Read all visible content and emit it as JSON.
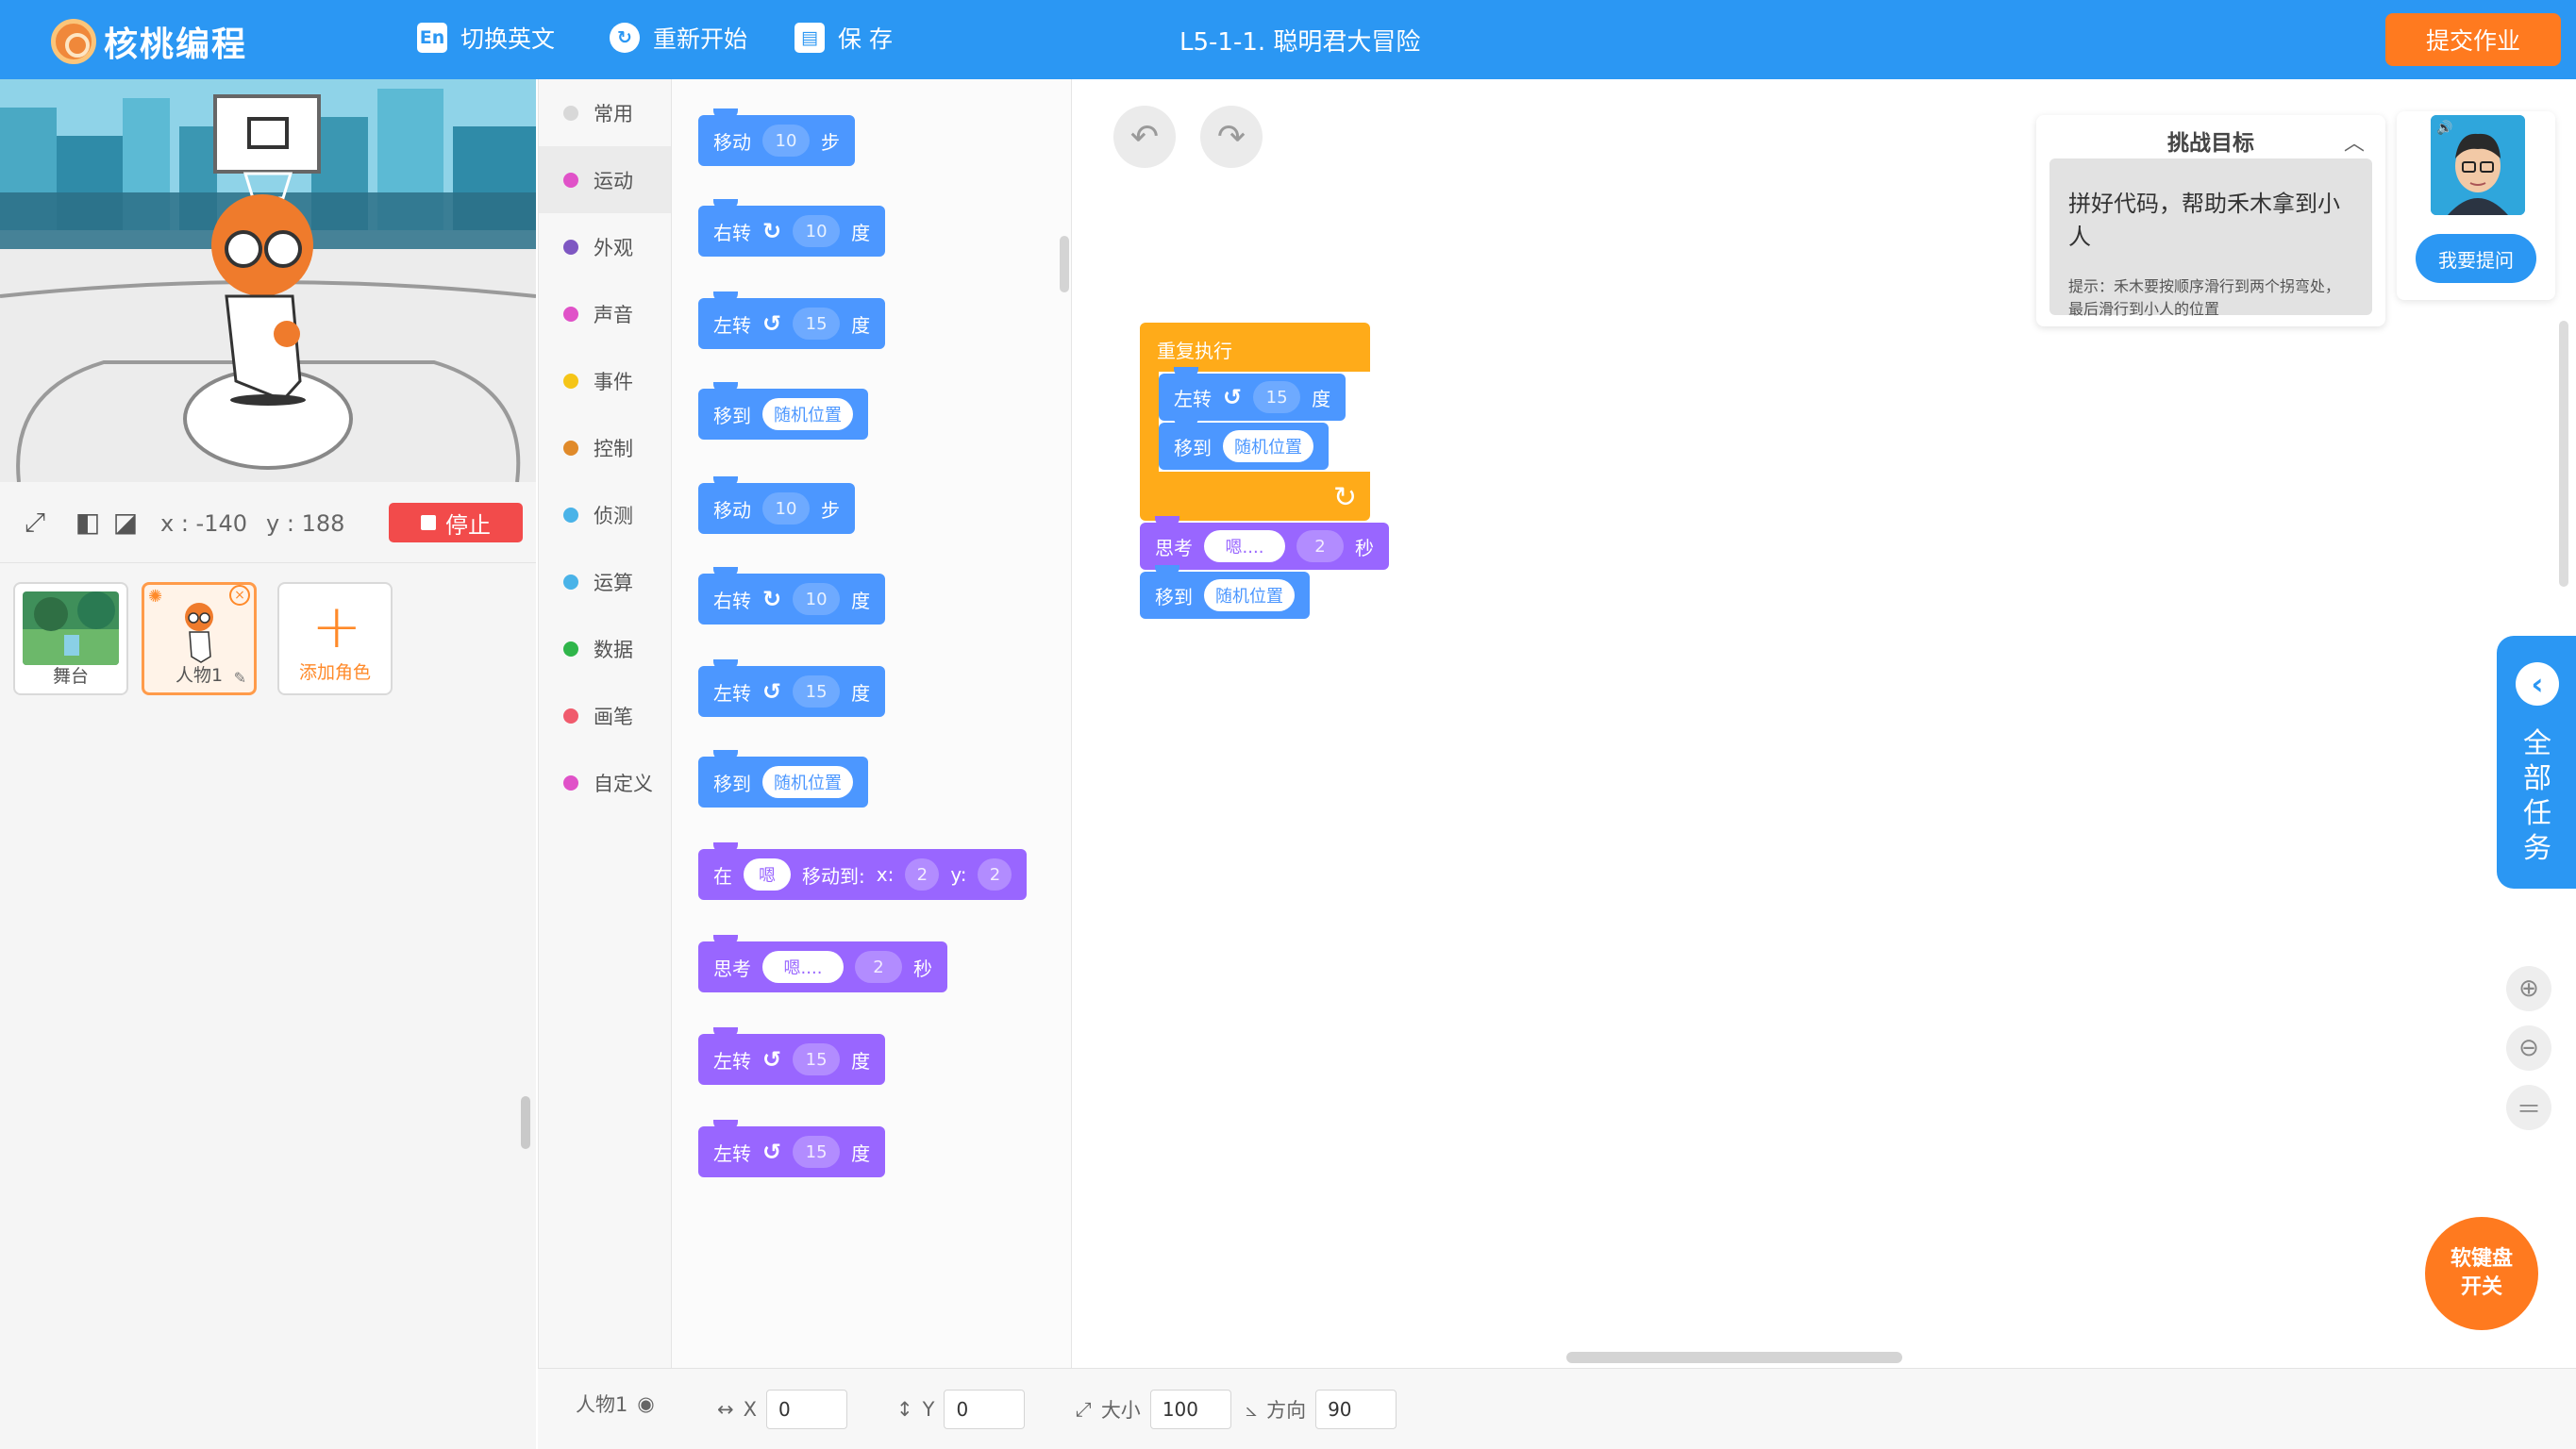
{
  "header": {
    "logo_text": "核桃编程",
    "switch_lang_label": "切换英文",
    "switch_lang_icon": "En",
    "restart_label": "重新开始",
    "save_label": "保 存",
    "lesson_title": "L5-1-1. 聪明君大冒险",
    "submit_label": "提交作业"
  },
  "stage": {
    "coord_x": "x : -140",
    "coord_y": "y : 188",
    "stop_label": "停止"
  },
  "sprites": {
    "items": [
      {
        "label": "舞台"
      },
      {
        "label": "人物1"
      }
    ],
    "add_label": "添加角色"
  },
  "categories": [
    {
      "label": "常用",
      "color": "#d8d8d8"
    },
    {
      "label": "运动",
      "color": "#e052c8"
    },
    {
      "label": "外观",
      "color": "#7e57c2"
    },
    {
      "label": "声音",
      "color": "#e052c8"
    },
    {
      "label": "事件",
      "color": "#f5c518"
    },
    {
      "label": "控制",
      "color": "#e08a2a"
    },
    {
      "label": "侦测",
      "color": "#4ab3e8"
    },
    {
      "label": "运算",
      "color": "#4ab3e8"
    },
    {
      "label": "数据",
      "color": "#2fb54a"
    },
    {
      "label": "画笔",
      "color": "#f05b6d"
    },
    {
      "label": "自定义",
      "color": "#e052c8"
    }
  ],
  "palette": {
    "move1": {
      "text": "移动",
      "value": "10",
      "unit": "步"
    },
    "right1": {
      "text": "右转",
      "value": "10",
      "unit": "度"
    },
    "left1": {
      "text": "左转",
      "value": "15",
      "unit": "度"
    },
    "goto1": {
      "text": "移到",
      "target": "随机位置"
    },
    "move2": {
      "text": "移动",
      "value": "10",
      "unit": "步"
    },
    "right2": {
      "text": "右转",
      "value": "10",
      "unit": "度"
    },
    "left2": {
      "text": "左转",
      "value": "15",
      "unit": "度"
    },
    "goto2": {
      "text": "移到",
      "target": "随机位置"
    },
    "glide": {
      "text": "在",
      "msg": "嗯",
      "mid": "移动到:",
      "xl": "x:",
      "xv": "2",
      "yl": "y:",
      "yv": "2"
    },
    "think": {
      "text": "思考",
      "msg": "嗯....",
      "secs": "2",
      "unit": "秒"
    },
    "left3": {
      "text": "左转",
      "value": "15",
      "unit": "度"
    },
    "left4": {
      "text": "左转",
      "value": "15",
      "unit": "度"
    }
  },
  "workspace": {
    "repeat_label": "重复执行",
    "inner_left": {
      "text": "左转",
      "value": "15",
      "unit": "度"
    },
    "inner_goto": {
      "text": "移到",
      "target": "随机位置"
    },
    "think": {
      "text": "思考",
      "msg": "嗯....",
      "secs": "2",
      "unit": "秒"
    },
    "goto": {
      "text": "移到",
      "target": "随机位置"
    }
  },
  "challenge": {
    "title": "挑战目标",
    "goal": "拼好代码，帮助禾木拿到小人",
    "hint": "提示：禾木要按顺序滑行到两个拐弯处，最后滑行到小人的位置"
  },
  "ask_label": "我要提问",
  "all_tasks_label": "全部任务",
  "keyboard_label_1": "软键盘",
  "keyboard_label_2": "开关",
  "props": {
    "sprite_name": "人物1",
    "x_label": "X",
    "x_value": "0",
    "y_label": "Y",
    "y_value": "0",
    "size_label": "大小",
    "size_value": "100",
    "dir_label": "方向",
    "dir_value": "90"
  },
  "colors": {
    "header_blue": "#2b97f3",
    "submit_orange": "#ff7a1f",
    "motion_blue": "#4c97ff",
    "looks_purple": "#9966ff",
    "control_orange": "#ffab19",
    "stop_red": "#f24b4b"
  }
}
